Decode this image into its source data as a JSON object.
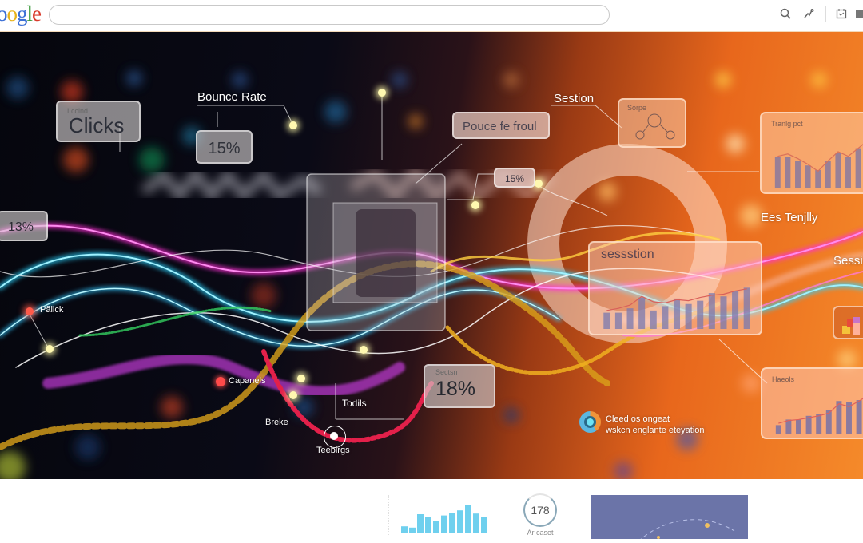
{
  "header": {
    "logo_letters": [
      "o",
      "o",
      "g",
      "l",
      "e"
    ],
    "logo_colors": [
      "#3b6fd6",
      "#e8b31a",
      "#3b6fd6",
      "#3a9a3a",
      "#d93a2b"
    ],
    "search_value": "",
    "icons": [
      "search-icon",
      "trend-icon",
      "calendar-icon",
      "bookmark-icon"
    ]
  },
  "hero": {
    "clicks_card": {
      "caption": "Lcclnd",
      "title": "Clicks"
    },
    "bounce_rate_label": "Bounce Rate",
    "bounce_value": "15%",
    "left_value": "13%",
    "pouce_card": "Pouce fe froul",
    "session_label": "Sestion",
    "node_card": {
      "caption": "Sorpe",
      "node_glyph": "%"
    },
    "small_value": "15%",
    "session_chart": {
      "title": "sessstion",
      "bars": [
        30,
        30,
        38,
        58,
        34,
        42,
        56,
        46,
        52,
        66,
        60,
        70,
        76
      ],
      "line": [
        34,
        38,
        44,
        60,
        50,
        48,
        54,
        52,
        58,
        62,
        64,
        70,
        74
      ]
    },
    "top_right_chart": {
      "title": "Tranlg pct",
      "bars": [
        55,
        55,
        48,
        40,
        32,
        48,
        62,
        55,
        70,
        80
      ],
      "line": [
        56,
        60,
        52,
        42,
        30,
        48,
        64,
        56,
        70,
        84
      ]
    },
    "bottom_right_chart": {
      "title": "Haeols",
      "bars": [
        20,
        32,
        32,
        40,
        44,
        52,
        72,
        70,
        74,
        86
      ],
      "line": [
        24,
        30,
        32,
        36,
        40,
        46,
        66,
        60,
        72,
        86
      ]
    },
    "ees_label": "Ees Tenjlly",
    "sess_label": "Sessi",
    "plick_label": "Pălick",
    "capanels_label": "Capanels",
    "todils_label": "Todils",
    "breke_label": "Breke",
    "teebirgs_label": "Teebirgs",
    "stat_card": {
      "caption": "Sectsn",
      "value": "18%"
    },
    "legend_line1": "Cleed os ongeat",
    "legend_line2": "wskcn englante eteyation"
  },
  "footer": {
    "mini_bars": [
      22,
      18,
      60,
      50,
      40,
      56,
      64,
      72,
      88,
      62,
      50
    ],
    "gauge_value": "178",
    "gauge_label": "Ar caset",
    "accent": "#6b74a8"
  }
}
